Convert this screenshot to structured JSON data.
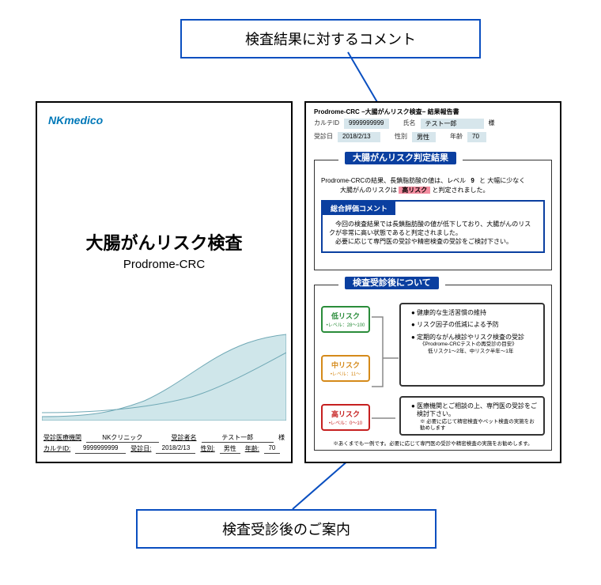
{
  "callouts": {
    "top": "検査結果に対するコメント",
    "bottom": "検査受診後のご案内"
  },
  "cover": {
    "logo": "NKmedico",
    "title_jp": "大腸がんリスク検査",
    "title_en": "Prodrome-CRC",
    "info": {
      "facility_label": "受診医療機関",
      "facility_value": "NKクリニック",
      "patient_label": "受診者名",
      "patient_value": "テスト一郎",
      "patient_honorific": "様",
      "karte_label": "カルテID:",
      "karte_value": "9999999999",
      "date_label": "受診日:",
      "date_value": "2018/2/13",
      "sex_label": "性別:",
      "sex_value": "男性",
      "age_label": "年齢:",
      "age_value": "70"
    }
  },
  "report": {
    "title": "Prodrome-CRC −大腸がんリスク検査− 結果報告書",
    "header": {
      "karte_label": "カルテID",
      "karte_value": "9999999999",
      "name_label": "氏名",
      "name_value": "テスト一郎",
      "name_honorific": "様",
      "date_label": "受診日",
      "date_value": "2018/2/13",
      "sex_label": "性別",
      "sex_value": "男性",
      "age_label": "年齢",
      "age_value": "70"
    },
    "result_section": {
      "title": "大腸がんリスク判定結果",
      "line1_pre": "Prodrome-CRCの結果、長鎖脂肪酸の値は、レベル",
      "level_value": "9",
      "line1_post": "と 大幅に少なく",
      "line2_pre": "大腸がんのリスクは",
      "risk_badge": "高リスク",
      "line2_post": "と判定されました。",
      "comment_tab": "総合評価コメント",
      "comment_body": "　今回の検査結果では長鎖脂肪酸の値が低下しており、大腸がんのリスクが非常に高い状態であると判定されました。\n　必要に応じて専門医の受診や精密検査の受診をご検討下さい。"
    },
    "followup_section": {
      "title": "検査受診後について",
      "risk_low": {
        "label": "低リスク",
        "range": "•レベル：28〜100"
      },
      "risk_mid": {
        "label": "中リスク",
        "range": "•レベル：11〜"
      },
      "risk_high": {
        "label": "高リスク",
        "range": "•レベル：0〜10"
      },
      "advice1": {
        "i1": "健康的な生活習慣の維持",
        "i2": "リスク因子の低減による予防",
        "i3": "定期的ながん検診やリスク検査の受診",
        "i3_sub1": "《Prodrome-CRCテストの再受診の目安》",
        "i3_sub2": "低リスク1〜2年、中リスク半年〜1年"
      },
      "advice2": {
        "i1": "医療機関とご相談の上、専門医の受診をご検討下さい。",
        "i1_sub": "※ 必要に応じて精密検査やペット検査の実施をお勧めします"
      },
      "note": "※あくまでも一例です。必要に応じて専門医の受診や精密検査の実施をお勧めします。"
    }
  }
}
